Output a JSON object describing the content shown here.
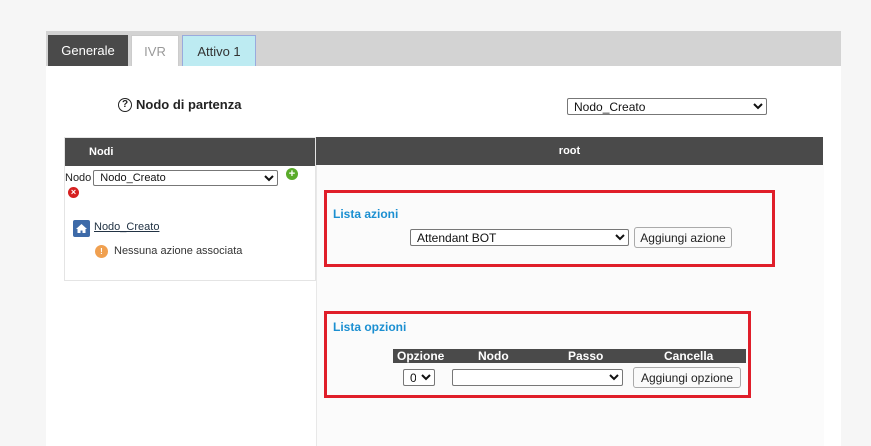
{
  "tabs": [
    {
      "label": "Generale"
    },
    {
      "label": "IVR"
    },
    {
      "label": "Attivo 1"
    }
  ],
  "start_node": {
    "label": "Nodo di partenza",
    "selected": "Nodo_Creato"
  },
  "nodes_panel": {
    "header": "Nodi",
    "nodo_label": "Nodo",
    "nodo_selected": "Nodo_Creato",
    "tree_node": "Nodo_Creato",
    "no_action_text": "Nessuna azione associata"
  },
  "root_panel": {
    "header": "root",
    "actions": {
      "title": "Lista azioni",
      "selected": "Attendant BOT",
      "add_button": "Aggiungi azione"
    },
    "options": {
      "title": "Lista opzioni",
      "columns": [
        "Opzione",
        "Nodo",
        "Passo",
        "Cancella"
      ],
      "option_value": "0",
      "node_value": "",
      "add_button": "Aggiungi opzione"
    }
  },
  "colors": {
    "accent": "#1b8fd1",
    "highlight_box": "#e01e2a",
    "header_bg": "#4a4a4a",
    "active_tab_bg": "#bdebf2"
  }
}
